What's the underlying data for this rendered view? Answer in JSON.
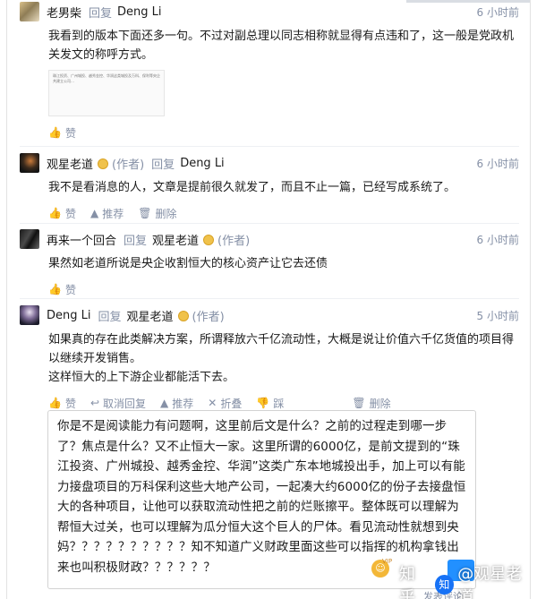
{
  "comments": [
    {
      "user": "老男柴",
      "reply_word": "回复",
      "reply_to": "Deng Li",
      "time": "6 小时前",
      "body": "我看到的版本下面还多一句。不过对副总理以同志相称就显得有点违和了，这一般是党政机关发文的称呼方式。",
      "thumb_text": "珠江投资、广州城投、越秀金控、华润这类城投及万科、保利等央企共建立公司…",
      "actions": {
        "like": "赞"
      }
    },
    {
      "user": "观星老道",
      "author_tag": "(作者)",
      "reply_word": "回复",
      "reply_to": "Deng Li",
      "time": "6 小时前",
      "body": "我不是看消息的人，文章是提前很久就发了，而且不止一篇，已经写成系统了。",
      "actions": {
        "like": "赞",
        "recommend": "推荐",
        "delete": "删除"
      }
    },
    {
      "user": "再来一个回合",
      "reply_word": "回复",
      "reply_to": "观星老道",
      "reply_to_tag": "(作者)",
      "time": "6 小时前",
      "body": "果然如老道所说是央企收割恒大的核心资产让它去还债",
      "actions": {
        "like": "赞"
      }
    },
    {
      "user": "Deng Li",
      "reply_word": "回复",
      "reply_to": "观星老道",
      "reply_to_tag": "(作者)",
      "time": "5 小时前",
      "body_line1": "如果真的存在此类解决方案，所谓释放六千亿流动性，大概是说让价值六千亿货值的项目得以继续开发销售。",
      "body_line2": "这样恒大的上下游企业都能活下去。",
      "actions": {
        "like": "赞",
        "cancel_reply": "取消回复",
        "recommend": "推荐",
        "fold": "折叠",
        "dislike": "踩",
        "delete": "删除"
      }
    }
  ],
  "reply_input": {
    "text": "你是不是阅读能力有问题啊，这里前后文是什么？之前的过程走到哪一步了？焦点是什么？又不止恒大一家。这里所谓的6000亿，是前文提到的“珠江投资、广州城投、越秀金控、华润”这类广东本地城投出手，加上可以有能力接盘项目的万科保利这些大地产公司，一起凑大约6000亿的份子去接盘恒大的各种项目，让他可以获取流动性把之前的烂账擦平。整体既可以理解为帮恒大过关，也可以理解为瓜分恒大这个巨人的尸体。看见流动性就想到央妈？？？？？？？？？？知不知道广义财政里面这些可以指挥的机构拿钱出来也叫积极财政？？？？？？",
    "vip": "VIP",
    "reply_button_partial": "发表评论"
  },
  "watermark": {
    "prefix": "知乎",
    "logo": "知",
    "suffix": "@观星老道"
  },
  "icons": {
    "like": "thumbs-up-icon",
    "recommend": "up-arrow-icon",
    "delete": "trash-icon",
    "cancel_reply": "reply-arrow-icon",
    "fold": "fold-icon",
    "dislike": "thumbs-down-icon",
    "emoji": "emoji-icon"
  },
  "colors": {
    "muted": "#8590a6",
    "text": "#1a1a1a",
    "badge": "#f0c24b",
    "brand": "#1772f6"
  }
}
